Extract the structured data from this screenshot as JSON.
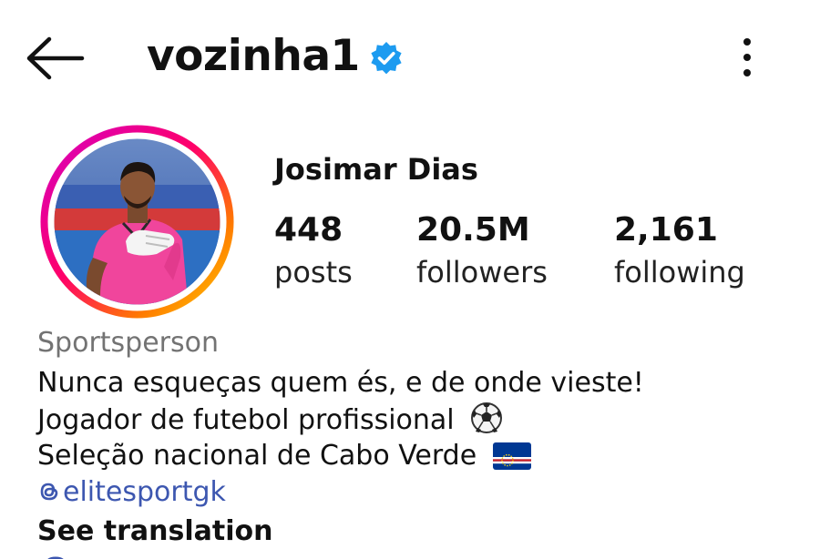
{
  "header": {
    "username": "vozinha1",
    "verified": true,
    "back_icon": "arrow-left-icon",
    "menu_icon": "more-vertical-icon"
  },
  "profile": {
    "full_name": "Josimar Dias",
    "avatar": "profile-photo",
    "stats": [
      {
        "value": "448",
        "label": "posts"
      },
      {
        "value": "20.5M",
        "label": "followers"
      },
      {
        "value": "2,161",
        "label": "following"
      }
    ]
  },
  "bio": {
    "category": "Sportsperson",
    "lines": [
      "Nunca esqueças quem és, e de onde vieste!",
      "Jogador de futebol profissional",
      "Seleção nacional de Cabo Verde"
    ],
    "line_icons": [
      "soccer-ball-icon",
      "cabo-verde-flag-icon"
    ],
    "threads_handle": "elitesportgk",
    "see_translation": "See translation"
  },
  "colors": {
    "text": "#111111",
    "muted": "#737373",
    "link": "#3d57b0",
    "verified": "#1d9bf0",
    "story_ring_start": "#d300c5",
    "story_ring_end": "#ffc400"
  }
}
